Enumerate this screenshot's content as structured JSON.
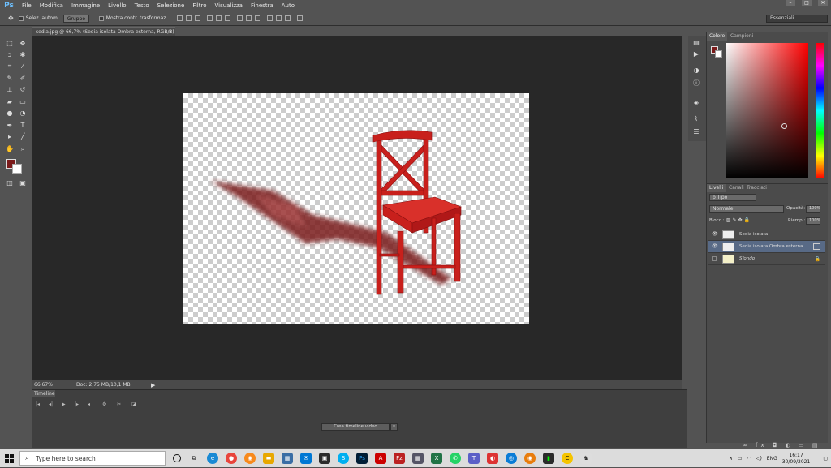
{
  "app": {
    "logo": "Ps"
  },
  "menu": [
    "File",
    "Modifica",
    "Immagine",
    "Livello",
    "Testo",
    "Selezione",
    "Filtro",
    "Visualizza",
    "Finestra",
    "Auto"
  ],
  "window_controls": [
    "–",
    "□",
    "✕"
  ],
  "options": {
    "auto_select_label": "Selez. autom.",
    "auto_select_value": "Gruppo",
    "transform_label": "Mostra contr. trasformaz.",
    "workspace": "Essenziali"
  },
  "document": {
    "tab_title": "sedia.jpg @ 66,7% (Sedia isolata Ombra esterna, RGB/8) *",
    "zoom": "66,67%",
    "doc_size": "Doc: 2,75 MB/10,1 MB"
  },
  "timeline": {
    "tab": "Timeline",
    "create_button": "Crea timeline video"
  },
  "color_panel": {
    "tab_color": "Colore",
    "tab_swatches": "Campioni",
    "foreground": "#7a1a1a",
    "background": "#ffffff"
  },
  "layers_panel": {
    "tabs": [
      "Livelli",
      "Canali",
      "Tracciati"
    ],
    "filter_label": "ρ Tipo",
    "blend_mode": "Normale",
    "opacity_label": "Opacità:",
    "opacity_value": "100%",
    "lock_label": "Blocc.:",
    "fill_label": "Riemp.:",
    "fill_value": "100%",
    "layers": [
      {
        "name": "Sedia isolata",
        "selected": false
      },
      {
        "name": "Sedia isolata Ombra esterna",
        "selected": true
      },
      {
        "name": "Sfondo",
        "selected": false
      }
    ]
  },
  "taskbar": {
    "search_placeholder": "Type here to search",
    "language": "ENG",
    "time": "16:17",
    "date": "30/09/2021"
  }
}
